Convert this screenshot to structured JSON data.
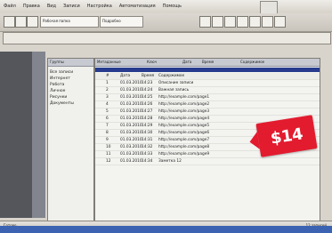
{
  "menu": {
    "items": [
      "Файл",
      "Правка",
      "Вид",
      "Записи",
      "Настройка",
      "Автоматизация",
      "Помощь"
    ]
  },
  "toolbar": {
    "group1": "Рабочая папка",
    "group2": "Подробно"
  },
  "address": {
    "value": ""
  },
  "panels": {
    "left_title": "Группы",
    "right_title": "Метаданные",
    "right_fields": [
      "Ключ",
      "Дата",
      "Время",
      "Содержимое"
    ]
  },
  "folders": [
    "Все записи",
    "Интернет",
    "Работа",
    "Личное",
    "Рисунки",
    "Документы"
  ],
  "list": {
    "headers": [
      "#",
      "Дата",
      "Время",
      "Содержимое"
    ],
    "rows": [
      {
        "num": "1",
        "date": "01.03.2010",
        "time": "14:23",
        "text": "Описание записи"
      },
      {
        "num": "2",
        "date": "01.03.2010",
        "time": "14:24",
        "text": "Важная запись"
      },
      {
        "num": "3",
        "date": "01.03.2010",
        "time": "14:25",
        "text": "http://example.com/page1"
      },
      {
        "num": "4",
        "date": "01.03.2010",
        "time": "14:26",
        "text": "http://example.com/page2"
      },
      {
        "num": "5",
        "date": "01.03.2010",
        "time": "14:27",
        "text": "http://example.com/page3"
      },
      {
        "num": "6",
        "date": "01.03.2010",
        "time": "14:28",
        "text": "http://example.com/page4"
      },
      {
        "num": "7",
        "date": "01.03.2010",
        "time": "14:29",
        "text": "http://example.com/page5"
      },
      {
        "num": "8",
        "date": "01.03.2010",
        "time": "14:30",
        "text": "http://example.com/page6"
      },
      {
        "num": "9",
        "date": "01.03.2010",
        "time": "14:31",
        "text": "http://example.com/page7"
      },
      {
        "num": "10",
        "date": "01.03.2010",
        "time": "14:32",
        "text": "http://example.com/page8"
      },
      {
        "num": "11",
        "date": "01.03.2010",
        "time": "14:33",
        "text": "http://example.com/page9"
      },
      {
        "num": "12",
        "date": "01.03.2010",
        "time": "14:34",
        "text": "Заметка 12"
      }
    ]
  },
  "status": {
    "left_text": "Готово",
    "right_text": "12 записей"
  },
  "price": {
    "label": "$14"
  },
  "colors": {
    "price_red": "#e31b2f",
    "band_blue": "#273c8e",
    "taskbar": "#3c63b1"
  }
}
